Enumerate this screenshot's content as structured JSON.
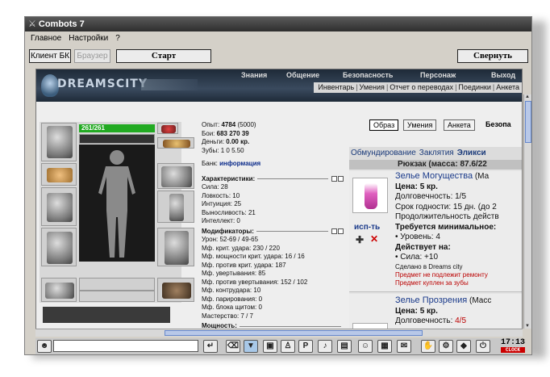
{
  "window": {
    "title": "Combots 7"
  },
  "menu": {
    "items": [
      "Главное",
      "Настройки",
      "?"
    ]
  },
  "toolbar": {
    "client": "Клиент БК",
    "browser": "Браузер",
    "start": "Старт",
    "collapse": "Свернуть"
  },
  "header": {
    "logo": "DREAMSCITY",
    "nav": [
      "Знания",
      "Общение",
      "Безопасность",
      "Персонаж",
      "Выход"
    ],
    "subnav": [
      "Инвентарь",
      "Умения",
      "Отчет о переводах",
      "Поединки",
      "Анкета"
    ]
  },
  "character": {
    "hp": "261/261",
    "slot_badges": [
      "270",
      "2"
    ]
  },
  "stats": {
    "exp_label": "Опыт:",
    "exp": "4784",
    "exp_next": "(5000)",
    "battles_label": "Бои:",
    "battles_win": "683",
    "battles_lose": "270",
    "battles_draw": "39",
    "money_label": "Деньги:",
    "money": "0.00 кр.",
    "teeth_label": "Зубы:",
    "teeth": "1 0 5.50",
    "bank_label": "Банк:",
    "bank_link": "информация",
    "characteristics": "Характеристики:",
    "char_rows": [
      "Сила: 28",
      "Ловкость: 10",
      "Интуиция: 25",
      "Выносливость: 21",
      "Интеллект: 0"
    ],
    "modifiers": "Модификаторы:",
    "mod_rows": [
      "Урон: 52-69 / 49-65",
      "Мф. крит. удара: 230 / 220",
      "Мф. мощности крит. удара: 16 / 16",
      "Мф. против крит. удара: 187",
      "Мф. увертывания: 85",
      "Мф. против увертывания: 152 / 102",
      "Мф. контрудара: 10",
      "Мф. парирования: 0",
      "Мф. блока щитом: 0",
      "Мастерство: 7 / 7"
    ],
    "power": "Мощность:"
  },
  "tabs": [
    "Образ",
    "Умения",
    "Анкета",
    "Безопа"
  ],
  "inventory": {
    "tabs": [
      "Обмундирование",
      "Заклятия",
      "Эликси"
    ],
    "backpack": "Рюкзак (масса: 87.6/22",
    "items": [
      {
        "name": "Зелье Могущества",
        "name_extra": "(Ма",
        "price": "Цена: 5 кр.",
        "durability": "Долговечность: 1/5",
        "expiry": "Срок годности: 15 дн. (до 2",
        "duration": "Продолжительность действ",
        "req_title": "Требуется минимальное:",
        "req": "• Уровень: 4",
        "effect_title": "Действует на:",
        "effect": "• Сила: +10",
        "made": "Сделано в Dreams city",
        "note1": "Предмет не подлежит ремонту",
        "note2": "Предмет куплен за зубы",
        "use": "исп-ть"
      },
      {
        "name": "Зелье Прозрения",
        "name_extra": "(Масс",
        "price": "Цена: 5 кр.",
        "durability_label": "Долговечность:",
        "durability_value": "4/5"
      }
    ]
  },
  "clock": {
    "time": "17:13",
    "label1": "CLOCK",
    "label2": "TIMER"
  },
  "colors": {
    "hp": "#22aa22",
    "link": "#1a3a8a",
    "warning": "#bb0000"
  }
}
